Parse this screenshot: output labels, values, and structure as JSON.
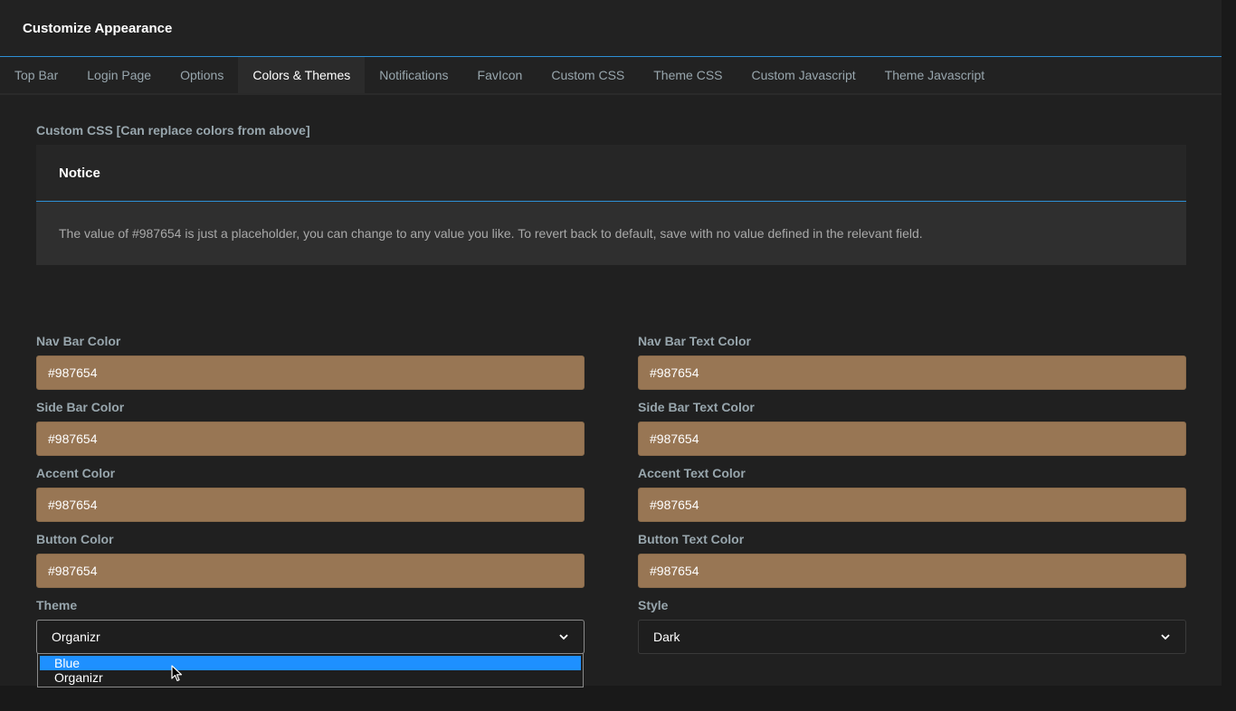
{
  "header": {
    "title": "Customize Appearance"
  },
  "tabs": [
    {
      "label": "Top Bar"
    },
    {
      "label": "Login Page"
    },
    {
      "label": "Options"
    },
    {
      "label": "Colors & Themes"
    },
    {
      "label": "Notifications"
    },
    {
      "label": "FavIcon"
    },
    {
      "label": "Custom CSS"
    },
    {
      "label": "Theme CSS"
    },
    {
      "label": "Custom Javascript"
    },
    {
      "label": "Theme Javascript"
    }
  ],
  "active_tab": "Colors & Themes",
  "section": {
    "label": "Custom CSS [Can replace colors from above]"
  },
  "notice": {
    "title": "Notice",
    "body": "The value of #987654 is just a placeholder, you can change to any value you like. To revert back to default, save with no value defined in the relevant field."
  },
  "fields": {
    "nav_bar_color": {
      "label": "Nav Bar Color",
      "value": "#987654"
    },
    "nav_bar_text_color": {
      "label": "Nav Bar Text Color",
      "value": "#987654"
    },
    "side_bar_color": {
      "label": "Side Bar Color",
      "value": "#987654"
    },
    "side_bar_text_color": {
      "label": "Side Bar Text Color",
      "value": "#987654"
    },
    "accent_color": {
      "label": "Accent Color",
      "value": "#987654"
    },
    "accent_text_color": {
      "label": "Accent Text Color",
      "value": "#987654"
    },
    "button_color": {
      "label": "Button Color",
      "value": "#987654"
    },
    "button_text_color": {
      "label": "Button Text Color",
      "value": "#987654"
    },
    "theme": {
      "label": "Theme",
      "value": "Organizr",
      "options": [
        "Blue",
        "Organizr"
      ],
      "highlighted": "Blue"
    },
    "style": {
      "label": "Style",
      "value": "Dark"
    }
  },
  "colors": {
    "accent": "#2d8fd5",
    "swatch": "#987654",
    "highlight": "#1e90ff"
  },
  "icons": {
    "select_chevron": "chevron-down-icon",
    "mouse": "mouse-pointer-icon"
  }
}
